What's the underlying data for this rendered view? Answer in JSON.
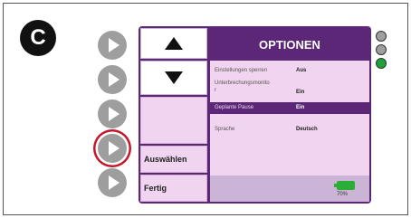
{
  "badge": "C",
  "softkeys": {
    "select_label": "Auswählen",
    "done_label": "Fertig"
  },
  "options": {
    "title": "OPTIONEN",
    "rows": [
      {
        "label": "Einstellungen sperren",
        "value": "Aus"
      },
      {
        "label": "Unterbrechungsmonito",
        "label2": "r",
        "value": "Ein"
      },
      {
        "label": "Geplante Pause",
        "value": "Ein",
        "selected": true
      },
      {
        "label": "Sprache",
        "value": "Deutsch"
      }
    ]
  },
  "battery": {
    "percent_label": "70%",
    "level": 0.7,
    "color": "#2bae36"
  },
  "leds": [
    {
      "name": "led-1",
      "color": "#9e9e9e"
    },
    {
      "name": "led-2",
      "color": "#9e9e9e"
    },
    {
      "name": "led-3",
      "color": "#1ea23c"
    }
  ],
  "colors": {
    "accent": "#5c2777",
    "panel": "#f1d4ef",
    "selection_ring": "#c4162a"
  }
}
